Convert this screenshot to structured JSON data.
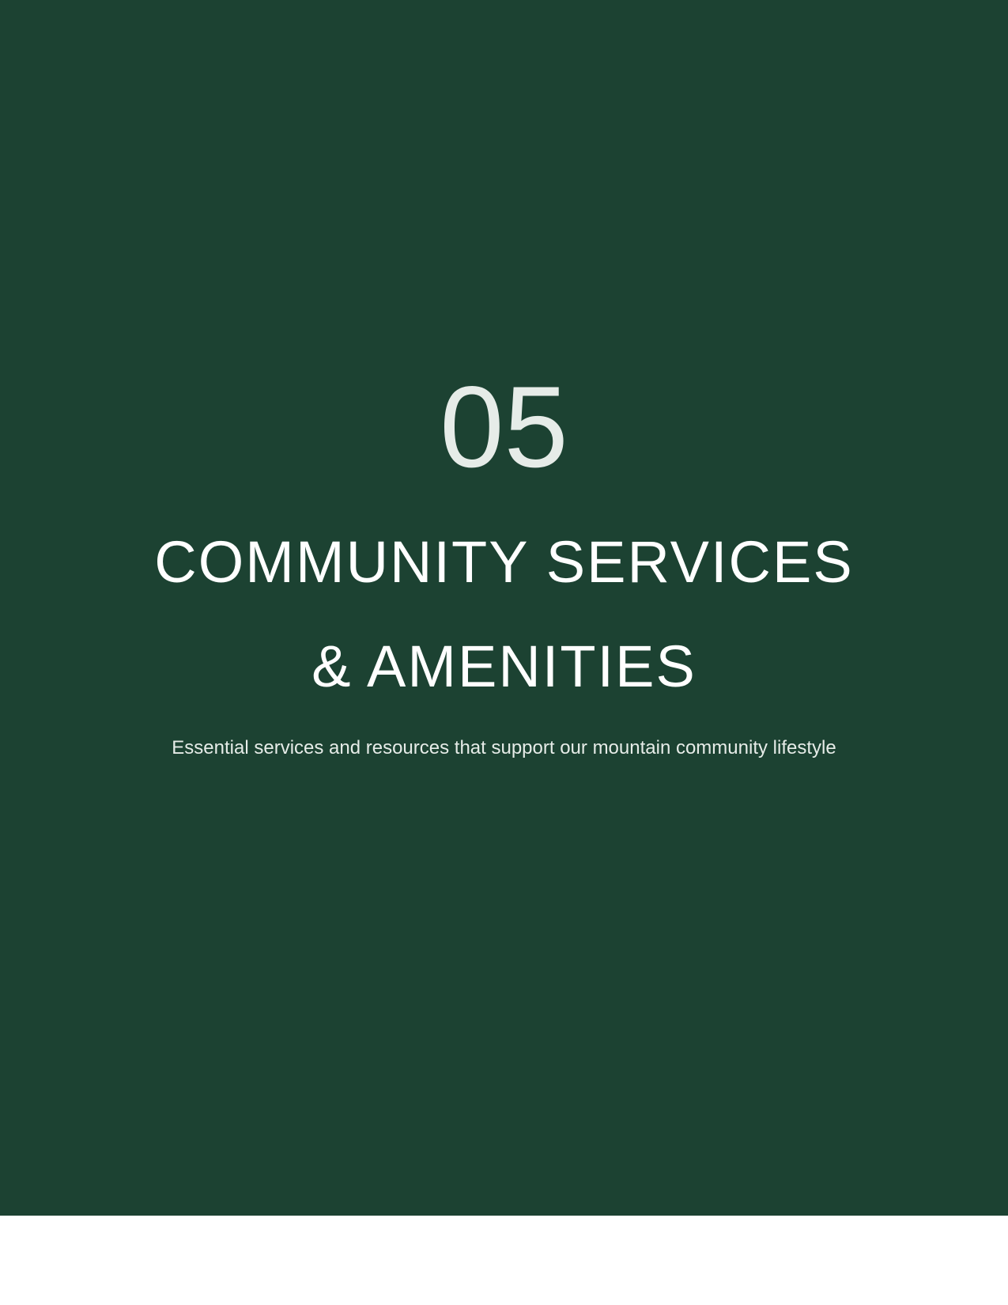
{
  "section": {
    "number": "05",
    "title_line_1": "COMMUNITY SERVICES",
    "title_line_2": "& AMENITIES",
    "subtitle": "Essential services and resources that support our mountain community lifestyle"
  },
  "colors": {
    "panel_background": "#1c4232",
    "text_primary": "#ffffff",
    "text_secondary": "#e6ece8",
    "page_background": "#ffffff"
  }
}
